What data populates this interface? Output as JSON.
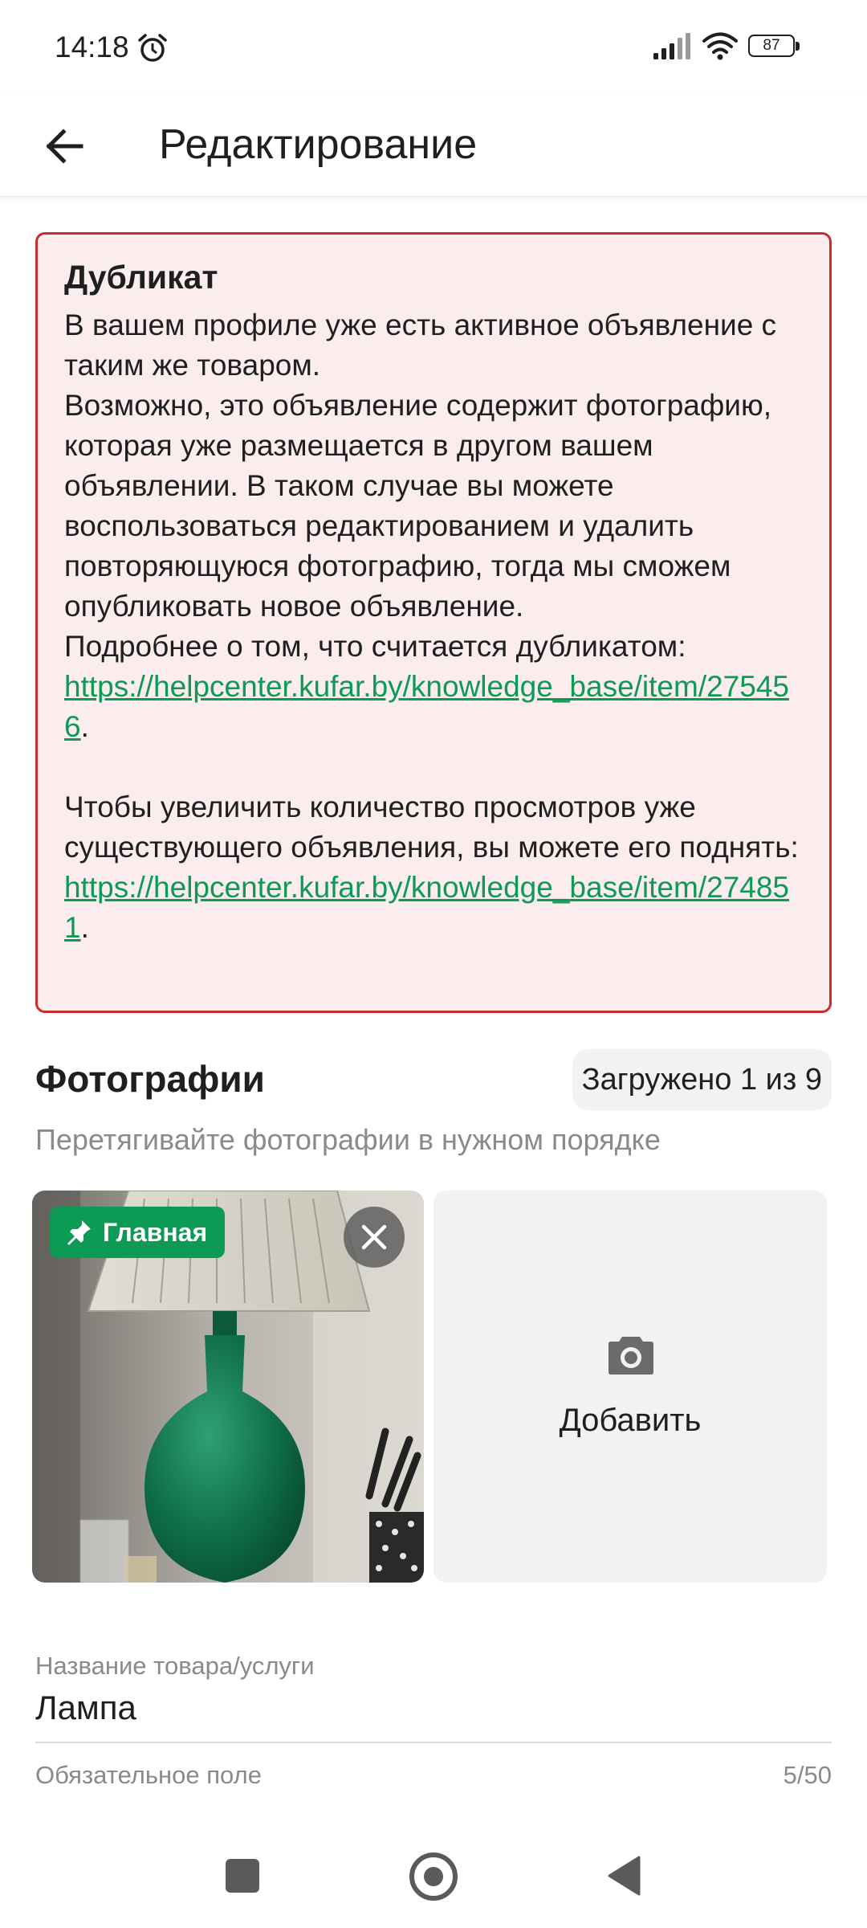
{
  "status_bar": {
    "time": "14:18",
    "battery": "87"
  },
  "app_bar": {
    "title": "Редактирование"
  },
  "duplicate_notice": {
    "title": "Дубликат",
    "text_1": "В вашем профиле уже есть активное объявление с таким же товаром.",
    "text_2": "Возможно, это объявление содержит фотографию, которая уже размещается в другом вашем объявлении. В таком случае вы можете воспользоваться редактированием и удалить повторяющуюся фотографию, тогда мы сможем опубликовать новое объявление.",
    "text_3": "Подробнее о том, что считается дубликатом:",
    "link_1": "https://helpcenter.kufar.by/knowledge_base/item/275456",
    "text_4": "Чтобы увеличить количество просмотров уже существующего объявления, вы можете его поднять:",
    "link_2": "https://helpcenter.kufar.by/knowledge_base/item/274851",
    "period": "."
  },
  "photos": {
    "title": "Фотографии",
    "upload_count": "Загружено 1 из 9",
    "hint": "Перетягивайте фотографии в нужном порядке",
    "main_badge": "Главная",
    "add_label": "Добавить"
  },
  "title_field": {
    "label": "Название товара/услуги",
    "value": "Лампа",
    "helper": "Обязательное поле",
    "counter": "5/50"
  },
  "colors": {
    "accent_green": "#0c9a55",
    "error_border": "#c62d2d",
    "error_background": "#fbecee"
  },
  "icons": [
    "back-arrow-icon",
    "alarm-icon",
    "signal-icon",
    "wifi-icon",
    "battery-icon",
    "pin-icon",
    "close-icon",
    "camera-icon"
  ]
}
